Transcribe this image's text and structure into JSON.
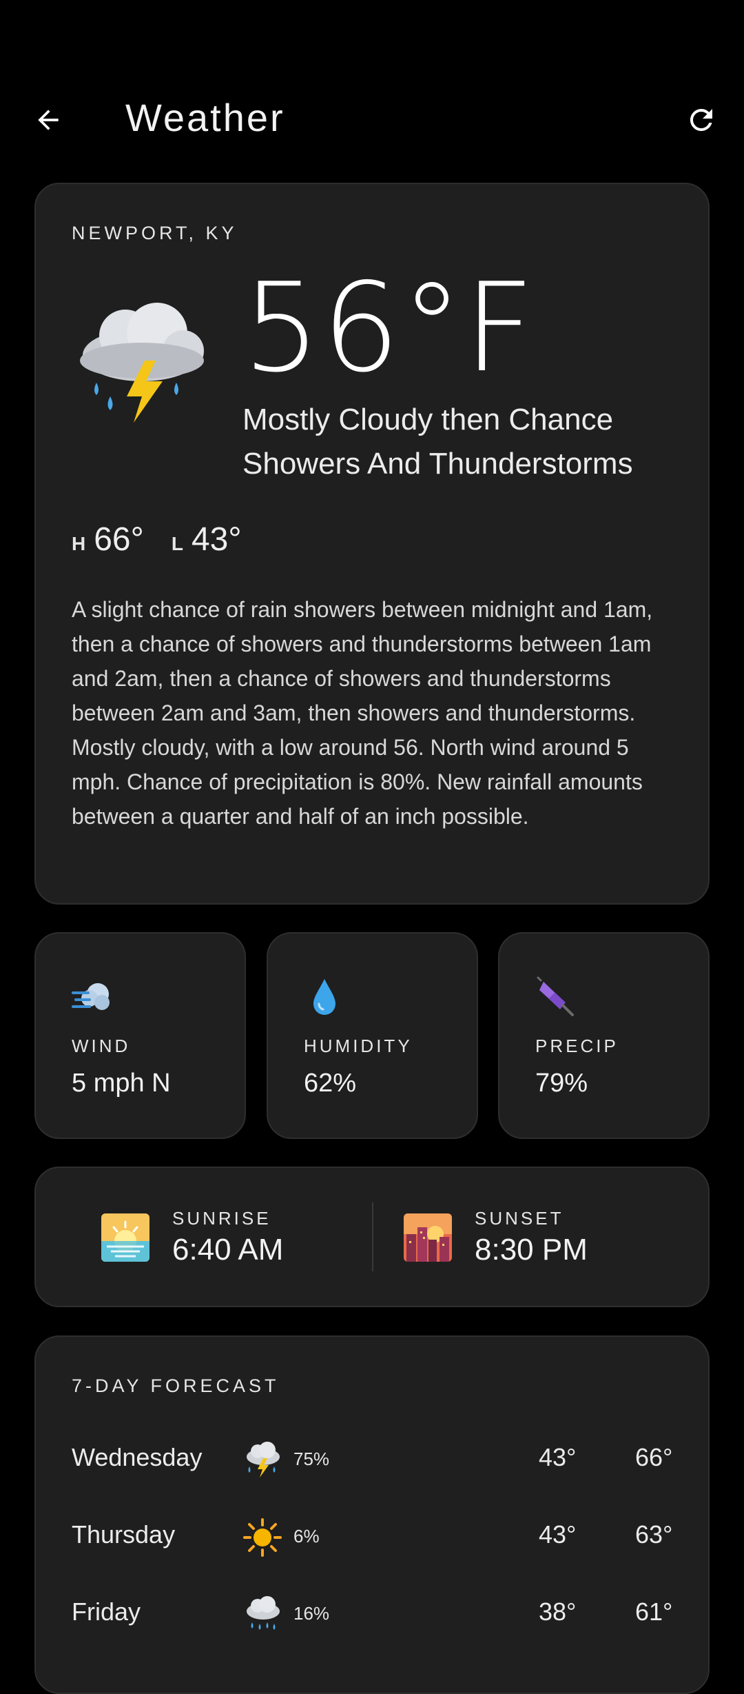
{
  "app": {
    "title": "Weather",
    "back_icon": "arrow-back-icon",
    "refresh_icon": "refresh-icon"
  },
  "current": {
    "location": "NEWPORT, KY",
    "icon": "thunderstorm-rain-icon",
    "temperature": "56°F",
    "condition": "Mostly Cloudy then Chance Showers And Thunderstorms",
    "high_label": "H",
    "high": "66°",
    "low_label": "L",
    "low": "43°",
    "detail": "A slight chance of rain showers between midnight and 1am, then a chance of showers and thunderstorms between 1am and 2am, then a chance of showers and thunderstorms between 2am and 3am, then showers and thunderstorms. Mostly cloudy, with a low around 56. North wind around 5 mph. Chance of precipitation is 80%. New rainfall amounts between a quarter and half of an inch possible."
  },
  "stats": {
    "wind": {
      "label": "WIND",
      "value": "5 mph N",
      "icon": "wind-icon"
    },
    "humidity": {
      "label": "HUMIDITY",
      "value": "62%",
      "icon": "droplet-icon"
    },
    "precip": {
      "label": "PRECIP",
      "value": "79%",
      "icon": "umbrella-icon"
    }
  },
  "sun": {
    "sunrise_label": "SUNRISE",
    "sunrise": "6:40 AM",
    "sunset_label": "SUNSET",
    "sunset": "8:30 PM"
  },
  "forecast": {
    "title": "7-DAY FORECAST",
    "days": [
      {
        "day": "Wednesday",
        "icon": "thunderstorm-icon",
        "precip": "75%",
        "low": "43°",
        "high": "66°"
      },
      {
        "day": "Thursday",
        "icon": "sun-icon",
        "precip": "6%",
        "low": "43°",
        "high": "63°"
      },
      {
        "day": "Friday",
        "icon": "rain-cloud-icon",
        "precip": "16%",
        "low": "38°",
        "high": "61°"
      }
    ]
  },
  "colors": {
    "background": "#000000",
    "card": "#1f1f1f",
    "card_border": "#2e2e2e",
    "text": "#ffffff"
  }
}
